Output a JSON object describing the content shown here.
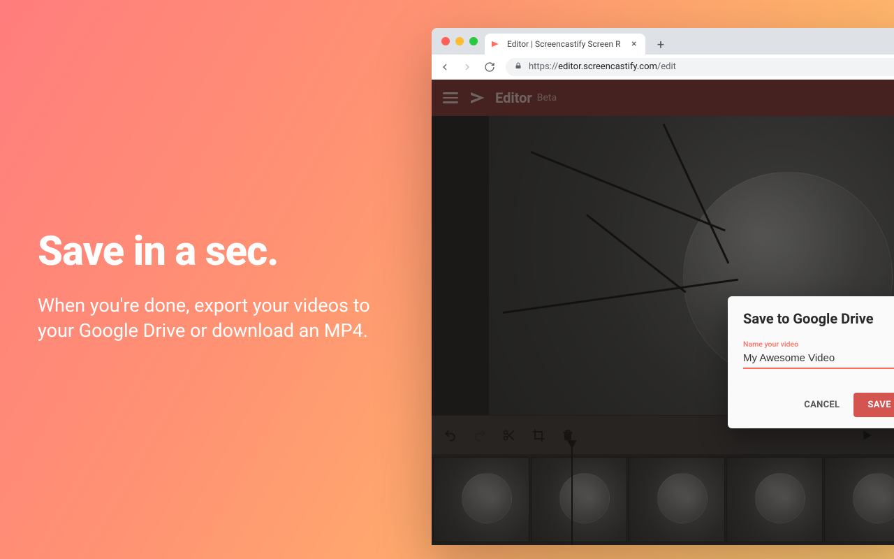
{
  "hero": {
    "headline": "Save in a sec.",
    "body": "When you're done, export your videos to your Google Drive or download an MP4."
  },
  "browser": {
    "tab_title": "Editor | Screencastify Screen R",
    "url_scheme": "https://",
    "url_host": "editor.screencastify.com",
    "url_path": "/edit"
  },
  "app": {
    "brand_name": "Editor",
    "brand_tag": "Beta"
  },
  "dialog": {
    "title": "Save to Google Drive",
    "field_label": "Name your video",
    "field_value": "My Awesome Video",
    "cancel_label": "CANCEL",
    "save_label": "SAVE"
  },
  "colors": {
    "accent": "#ff6f61",
    "primary_button": "#d45550"
  }
}
